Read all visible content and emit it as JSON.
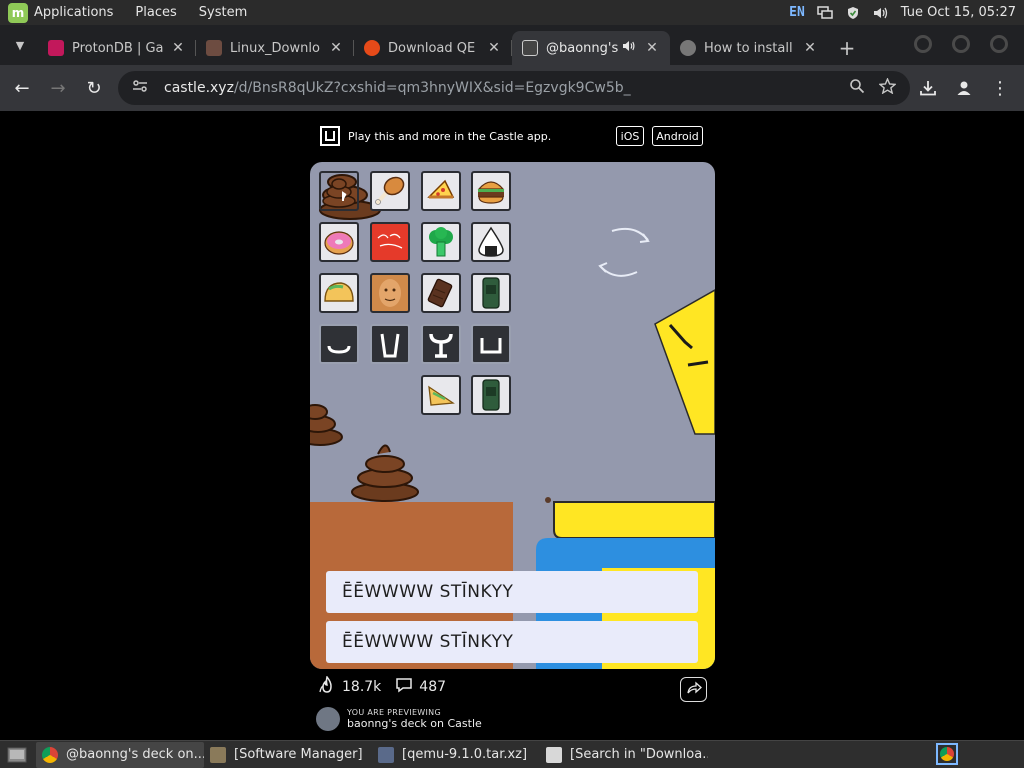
{
  "system_bar": {
    "menus": [
      "Applications",
      "Places",
      "System"
    ],
    "keyboard_layout": "EN",
    "clock": "Tue Oct 15, 05:27",
    "icons": [
      "mint-logo-icon",
      "network-icon",
      "shield-icon",
      "volume-icon"
    ]
  },
  "browser": {
    "tabs": [
      {
        "title": "ProtonDB | Ga",
        "favicon_color": "#c2185b"
      },
      {
        "title": "Linux_Downlo",
        "favicon_color": "#6d4c41"
      },
      {
        "title": "Download QE",
        "favicon_color": "#e64a19"
      },
      {
        "title": "@baonng's",
        "favicon_color": "#444444",
        "active": true
      },
      {
        "title": "How to install",
        "favicon_color": "#777777"
      }
    ],
    "url_host": "castle.xyz",
    "url_path": "/d/BnsR8qUkZ?cxshid=qm3hnyWIX&sid=Egzvgk9Cw5b_"
  },
  "castle": {
    "banner_text": "Play this and more in the Castle app.",
    "ios_label": "iOS",
    "android_label": "Android",
    "dialog_lines": [
      "ĒĒWWWW STĪNKYY",
      "ĒĒWWWW STĪNKYY"
    ],
    "likes": "18.7k",
    "comments": "487",
    "preview_label": "YOU ARE PREVIEWING",
    "deck_caption": "baonng's deck on Castle",
    "colors": {
      "game_bg": "#9499ad",
      "yellow": "#ffe623",
      "blue": "#2d8fe0",
      "brown": "#b8693a"
    }
  },
  "taskbar": {
    "items": [
      {
        "label": "@baonng's deck on...",
        "active": true
      },
      {
        "label": "[Software Manager]",
        "active": false
      },
      {
        "label": "[qemu-9.1.0.tar.xz]",
        "active": false
      },
      {
        "label": "[Search in \"Downloa...",
        "active": false
      }
    ]
  }
}
